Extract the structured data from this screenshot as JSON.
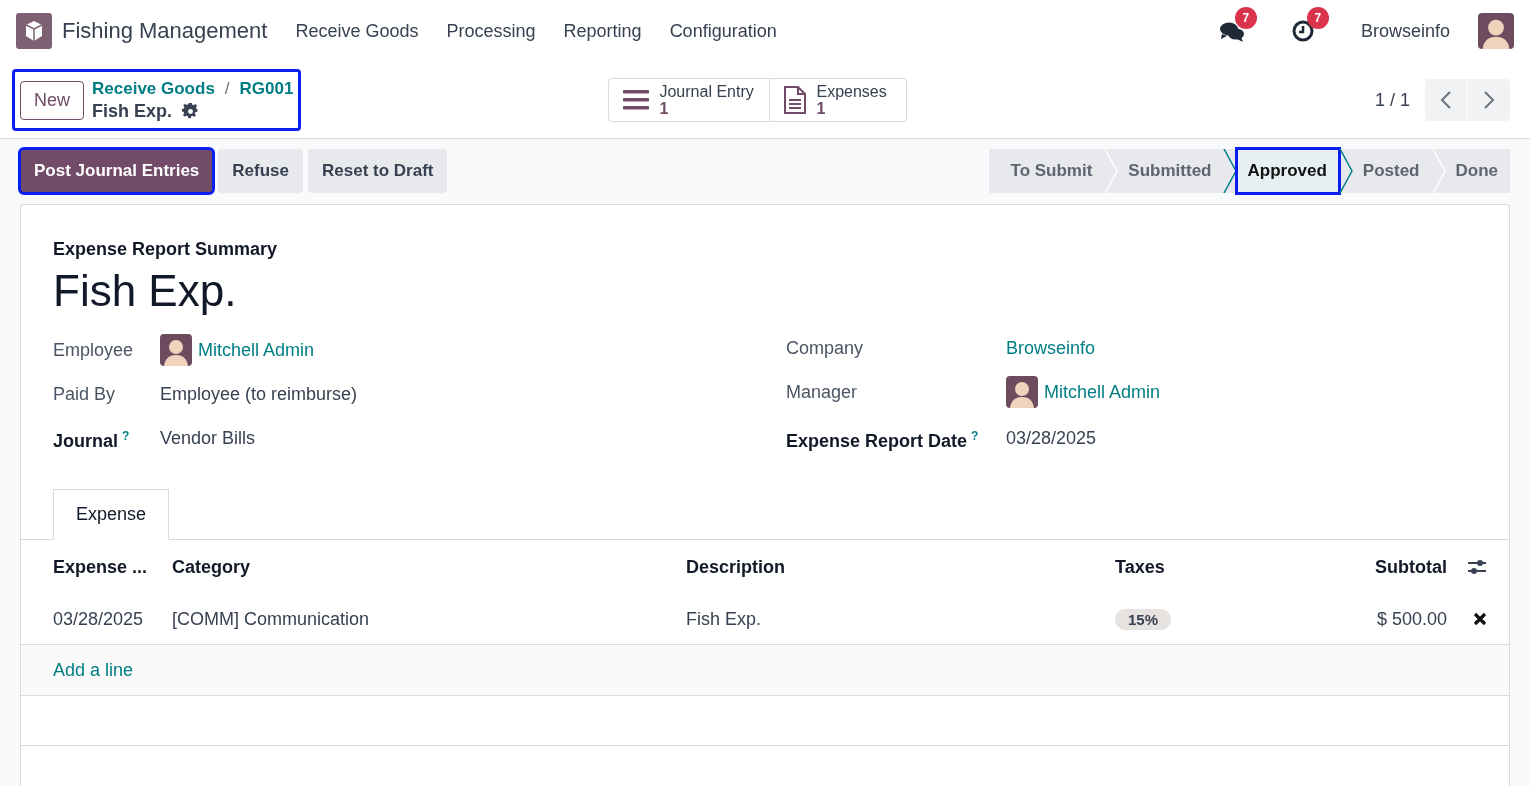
{
  "navbar": {
    "app_name": "Fishing Management",
    "menu": [
      "Receive Goods",
      "Processing",
      "Reporting",
      "Configuration"
    ],
    "messages_badge": "7",
    "activities_badge": "7",
    "user": "Browseinfo"
  },
  "control_panel": {
    "new_button": "New",
    "breadcrumbs": [
      "Receive Goods",
      "RG001"
    ],
    "separator": "/",
    "record_name": "Fish Exp.",
    "highlighted": true,
    "smart_buttons": [
      {
        "kind": "list",
        "label": "Journal Entry",
        "count": "1"
      },
      {
        "kind": "document",
        "label": "Expenses",
        "count": "1"
      }
    ],
    "pager": "1 / 1"
  },
  "action_buttons": [
    {
      "label": "Post Journal Entries",
      "kind": "primary",
      "highlighted": true
    },
    {
      "label": "Refuse",
      "kind": "secondary",
      "highlighted": false
    },
    {
      "label": "Reset to Draft",
      "kind": "secondary",
      "highlighted": false
    }
  ],
  "stages": [
    {
      "label": "To Submit",
      "selected": false,
      "highlighted": false
    },
    {
      "label": "Submitted",
      "selected": false,
      "highlighted": false
    },
    {
      "label": "Approved",
      "selected": true,
      "highlighted": true
    },
    {
      "label": "Posted",
      "selected": false,
      "highlighted": false
    },
    {
      "label": "Done",
      "selected": false,
      "highlighted": false
    }
  ],
  "form": {
    "subtitle": "Expense Report Summary",
    "title": "Fish Exp.",
    "left_fields": [
      {
        "label": "Employee",
        "value": "Mitchell Admin",
        "kind": "user",
        "required": false
      },
      {
        "label": "Paid By",
        "value": "Employee (to reimburse)",
        "kind": "text",
        "required": false
      },
      {
        "label": "Journal",
        "help": "?",
        "value": "Vendor Bills",
        "kind": "text",
        "required": true
      }
    ],
    "right_fields": [
      {
        "label": "Company",
        "value": "Browseinfo",
        "kind": "link",
        "required": false
      },
      {
        "label": "Manager",
        "value": "Mitchell Admin",
        "kind": "user",
        "required": false
      },
      {
        "label": "Expense Report Date",
        "help": "?",
        "value": "03/28/2025",
        "kind": "text",
        "required": true
      }
    ]
  },
  "tabs": [
    {
      "label": "Expense",
      "selected": true
    }
  ],
  "table": {
    "columns": [
      "Expense ...",
      "Category",
      "Description",
      "Taxes",
      "Subtotal"
    ],
    "rows": [
      {
        "cells": [
          "03/28/2025",
          "[COMM] Communication",
          "Fish Exp.",
          "15%",
          "$ 500.00"
        ]
      }
    ],
    "add_line": "Add a line"
  }
}
